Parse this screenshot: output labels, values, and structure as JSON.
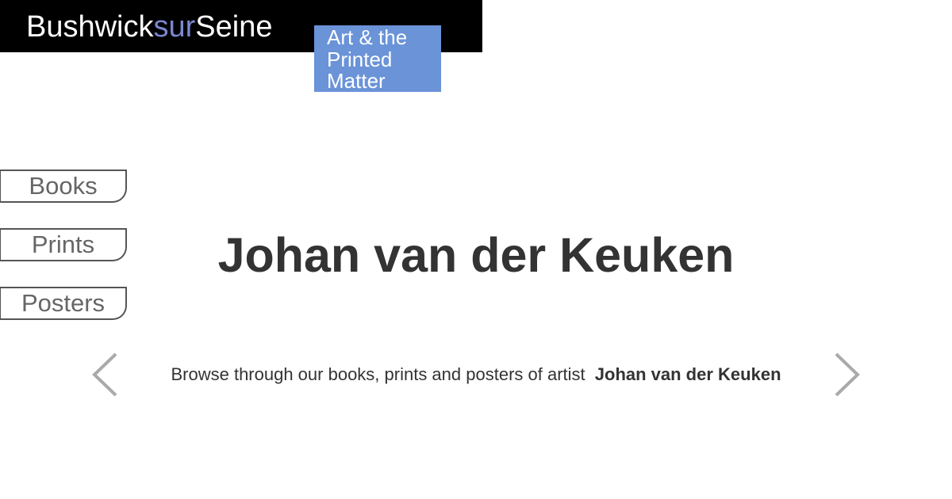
{
  "header": {
    "logo": {
      "part1": "Bushwick",
      "part2": "sur",
      "part3": "Seine"
    },
    "tagline": {
      "line1": "Art & the",
      "line2": "Printed",
      "line3": "Matter"
    }
  },
  "nav": {
    "books_label": "Books",
    "prints_label": "Prints",
    "posters_label": "Posters"
  },
  "main": {
    "artist_name": "Johan van der Keuken",
    "browse_prefix": "Browse through our books, prints and posters of artist",
    "browse_artist": "Johan van der Keuken"
  },
  "icons": {
    "prev": "chevron-left-icon",
    "next": "chevron-right-icon"
  },
  "colors": {
    "header_bg": "#000000",
    "logo_accent": "#7b86d0",
    "tagline_bg": "#6a93d8",
    "text": "#333333",
    "arrow": "#aaaaaa"
  }
}
